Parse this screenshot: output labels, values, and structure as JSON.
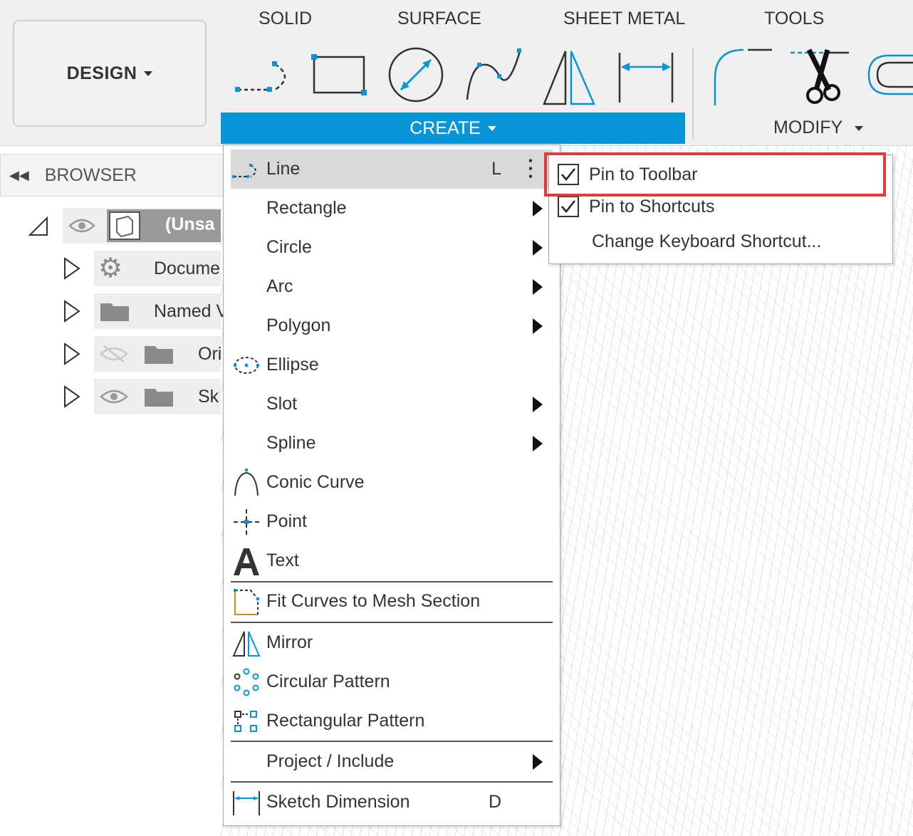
{
  "toolbar": {
    "workspace_label": "DESIGN",
    "tabs": [
      "SOLID",
      "SURFACE",
      "SHEET METAL",
      "TOOLS"
    ],
    "create_label": "CREATE",
    "modify_label": "MODIFY"
  },
  "browser": {
    "title": "BROWSER",
    "rows": [
      {
        "label": "(Unsa"
      },
      {
        "label": "Docume"
      },
      {
        "label": "Named V"
      },
      {
        "label": "Ori"
      },
      {
        "label": "Sk"
      }
    ]
  },
  "create_menu": {
    "items": [
      {
        "label": "Line",
        "shortcut": "L",
        "icon": "line-icon",
        "highlighted": true
      },
      {
        "label": "Rectangle",
        "submenu": true
      },
      {
        "label": "Circle",
        "submenu": true
      },
      {
        "label": "Arc",
        "submenu": true
      },
      {
        "label": "Polygon",
        "submenu": true
      },
      {
        "label": "Ellipse",
        "icon": "ellipse-icon"
      },
      {
        "label": "Slot",
        "submenu": true
      },
      {
        "label": "Spline",
        "submenu": true
      },
      {
        "label": "Conic Curve",
        "icon": "conic-curve-icon"
      },
      {
        "label": "Point",
        "icon": "point-icon"
      },
      {
        "label": "Text",
        "icon": "text-icon"
      },
      {
        "label": "Fit Curves to Mesh Section",
        "icon": "fit-curves-icon"
      },
      {
        "label": "Mirror",
        "icon": "mirror-icon"
      },
      {
        "label": "Circular Pattern",
        "icon": "circular-pattern-icon"
      },
      {
        "label": "Rectangular Pattern",
        "icon": "rectangular-pattern-icon"
      },
      {
        "label": "Project / Include",
        "submenu": true
      },
      {
        "label": "Sketch Dimension",
        "shortcut": "D",
        "icon": "sketch-dimension-icon"
      }
    ]
  },
  "line_submenu": {
    "items": [
      {
        "label": "Pin to Toolbar",
        "checked": true
      },
      {
        "label": "Pin to Shortcuts",
        "checked": true
      },
      {
        "label": "Change Keyboard Shortcut...",
        "checked": false
      }
    ]
  },
  "colors": {
    "accent": "#0696d7",
    "highlight_border": "#e0393e"
  }
}
